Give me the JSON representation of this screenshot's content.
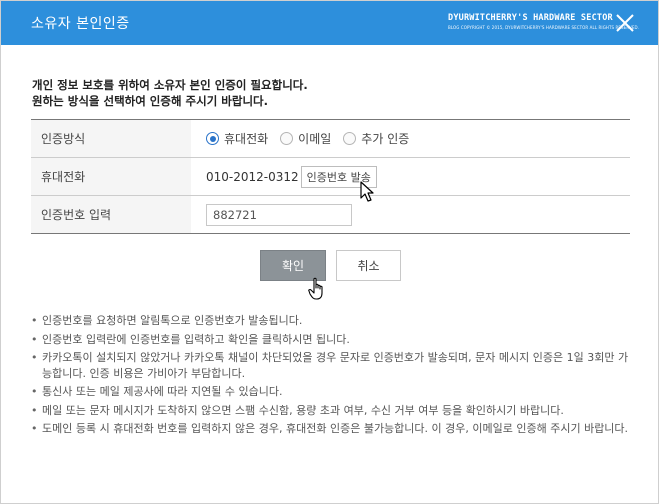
{
  "window": {
    "title": "소유자 본인인증",
    "brand_main": "DYURWITCHERRY'S HARDWARE SECTOR",
    "brand_sub": "BLOG COPYRIGHT © 2015, DYURWITCHERRY'S HARDWARE SECTOR ALL RIGHTS RESERVED."
  },
  "intro": {
    "line1": "개인 정보 보호를 위하여 소유자 본인 인증이 필요합니다.",
    "line2": "원하는 방식을 선택하여 인증해 주시기 바랍니다."
  },
  "form": {
    "method_label": "인증방식",
    "methods": [
      {
        "label": "휴대전화",
        "checked": true
      },
      {
        "label": "이메일",
        "checked": false
      },
      {
        "label": "추가 인증",
        "checked": false
      }
    ],
    "phone_label": "휴대전화",
    "phone_number": "010-2012-0312",
    "send_button": "인증번호 발송",
    "code_label": "인증번호 입력",
    "code_value": "882721"
  },
  "buttons": {
    "confirm": "확인",
    "cancel": "취소"
  },
  "notes": [
    "인증번호를 요청하면 알림톡으로 인증번호가 발송됩니다.",
    "인증번호 입력란에 인증번호를 입력하고 확인을 클릭하시면 됩니다.",
    "카카오톡이 설치되지 않았거나 카카오톡 채널이 차단되었을 경우 문자로 인증번호가 발송되며, 문자 메시지 인증은 1일 3회만 가능합니다. 인증 비용은 가비아가 부담합니다.",
    "통신사 또는 메일 제공사에 따라 지연될 수 있습니다.",
    "메일 또는 문자 메시지가 도착하지 않으면 스팸 수신함, 용량 초과 여부, 수신 거부 여부 등을 확인하시기 바랍니다.",
    "도메인 등록 시 휴대전화 번호를 입력하지 않은 경우, 휴대전화 인증은 불가능합니다. 이 경우, 이메일로 인증해 주시기 바랍니다."
  ],
  "colors": {
    "titlebar": "#2d8fdc",
    "radio_checked": "#2a73c9",
    "confirm_button": "#8c9398"
  }
}
